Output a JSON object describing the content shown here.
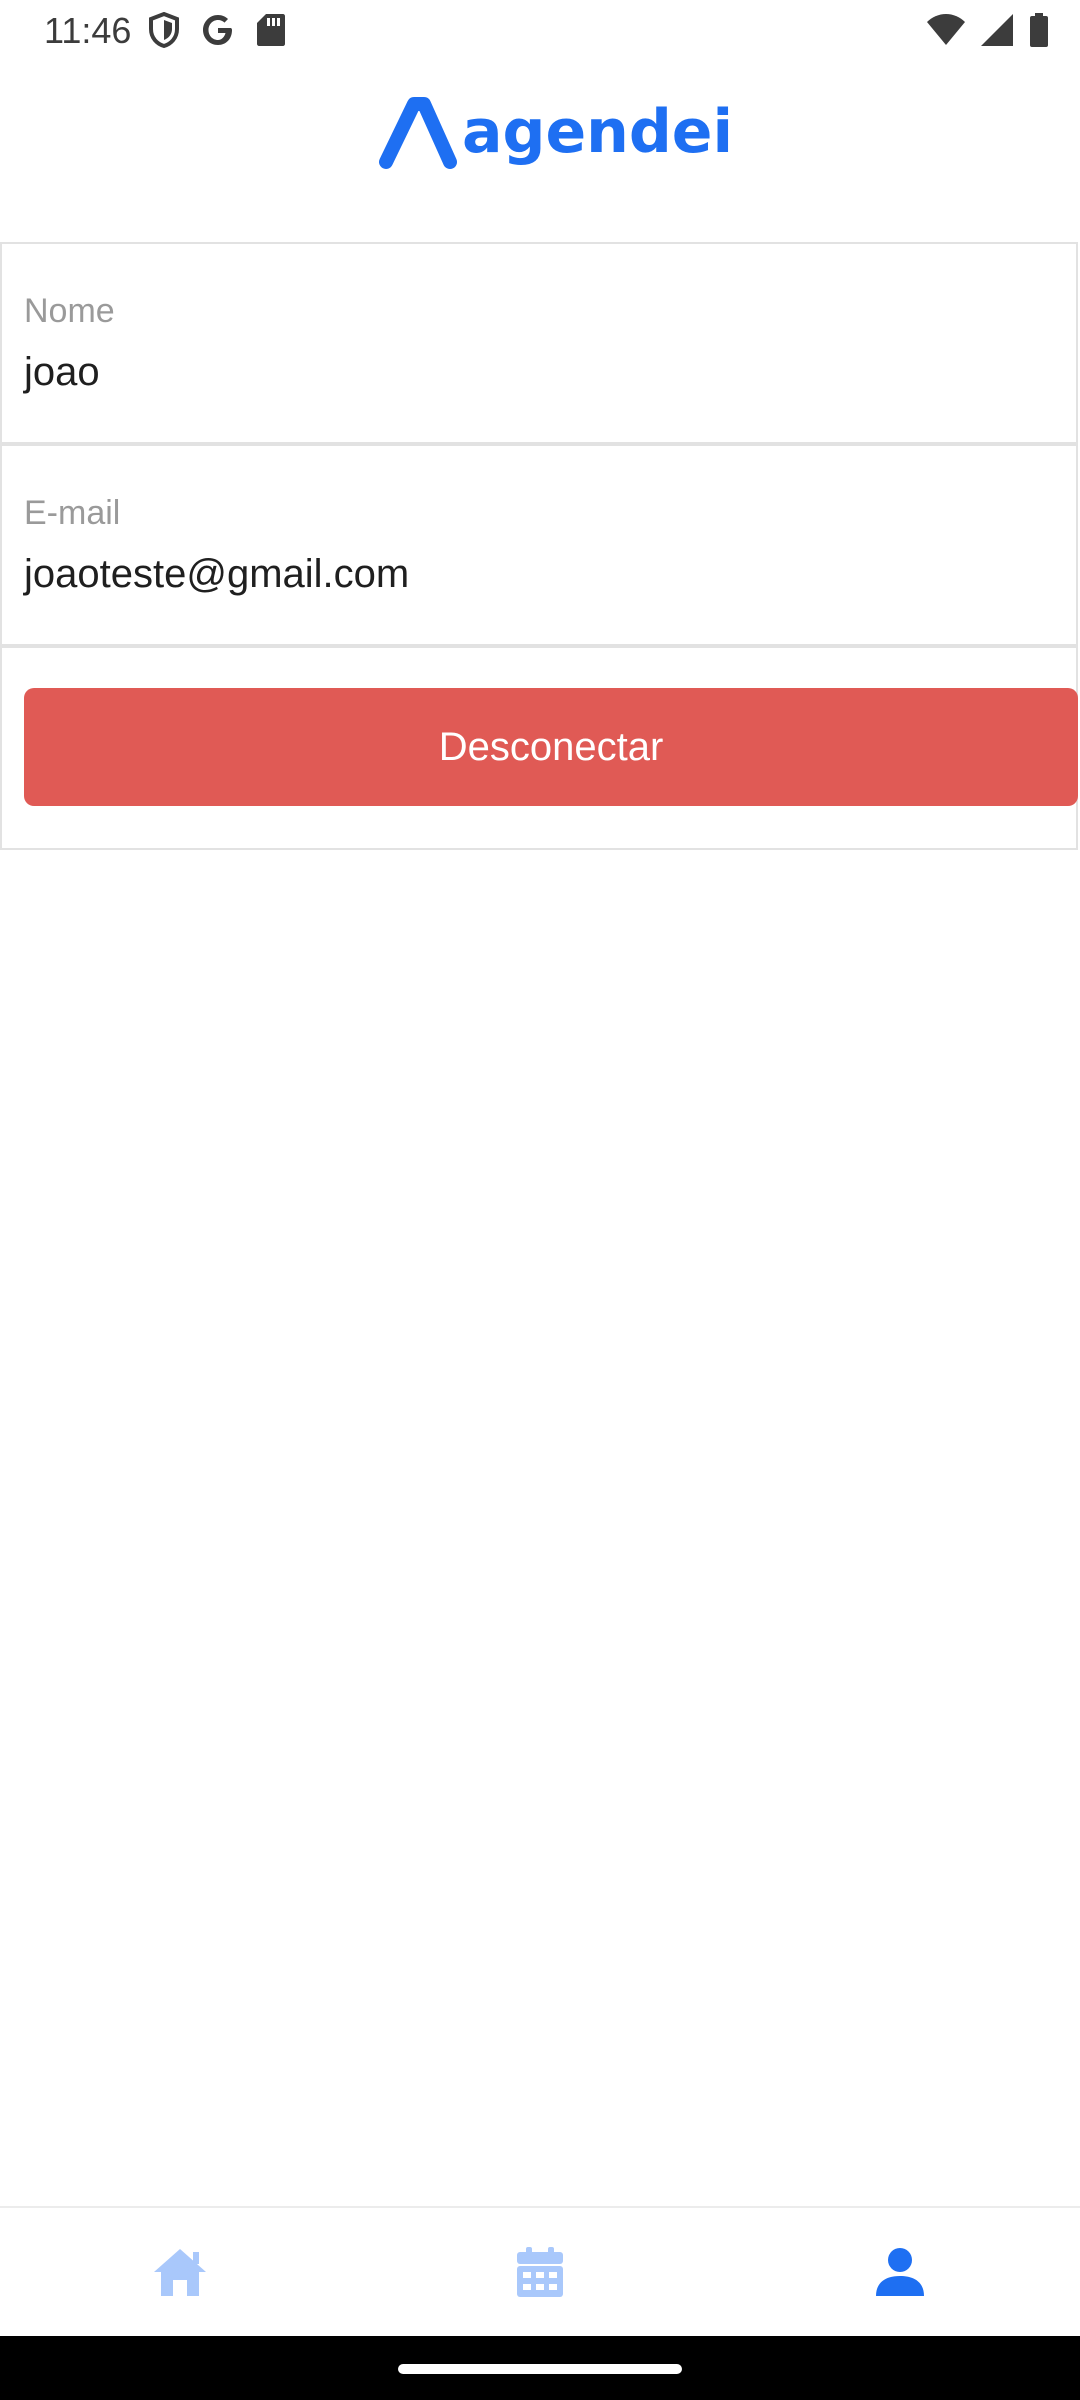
{
  "status_bar": {
    "time": "11:46",
    "left_icons": [
      "shield-icon",
      "google-icon",
      "sd-card-icon"
    ],
    "right_icons": [
      "wifi-icon",
      "signal-icon",
      "battery-icon"
    ]
  },
  "header": {
    "logo_text": "agendei",
    "brand_color": "#1e6ff2"
  },
  "profile": {
    "name_label": "Nome",
    "name_value": "joao",
    "email_label": "E-mail",
    "email_value": "joaoteste@gmail.com",
    "logout_label": "Desconectar",
    "logout_color": "#e05a55"
  },
  "bottom_nav": {
    "items": [
      {
        "icon": "home-icon",
        "active": false
      },
      {
        "icon": "calendar-icon",
        "active": false
      },
      {
        "icon": "user-icon",
        "active": true
      }
    ],
    "active_color": "#1e6ff2",
    "inactive_color": "#a9c8fb"
  }
}
